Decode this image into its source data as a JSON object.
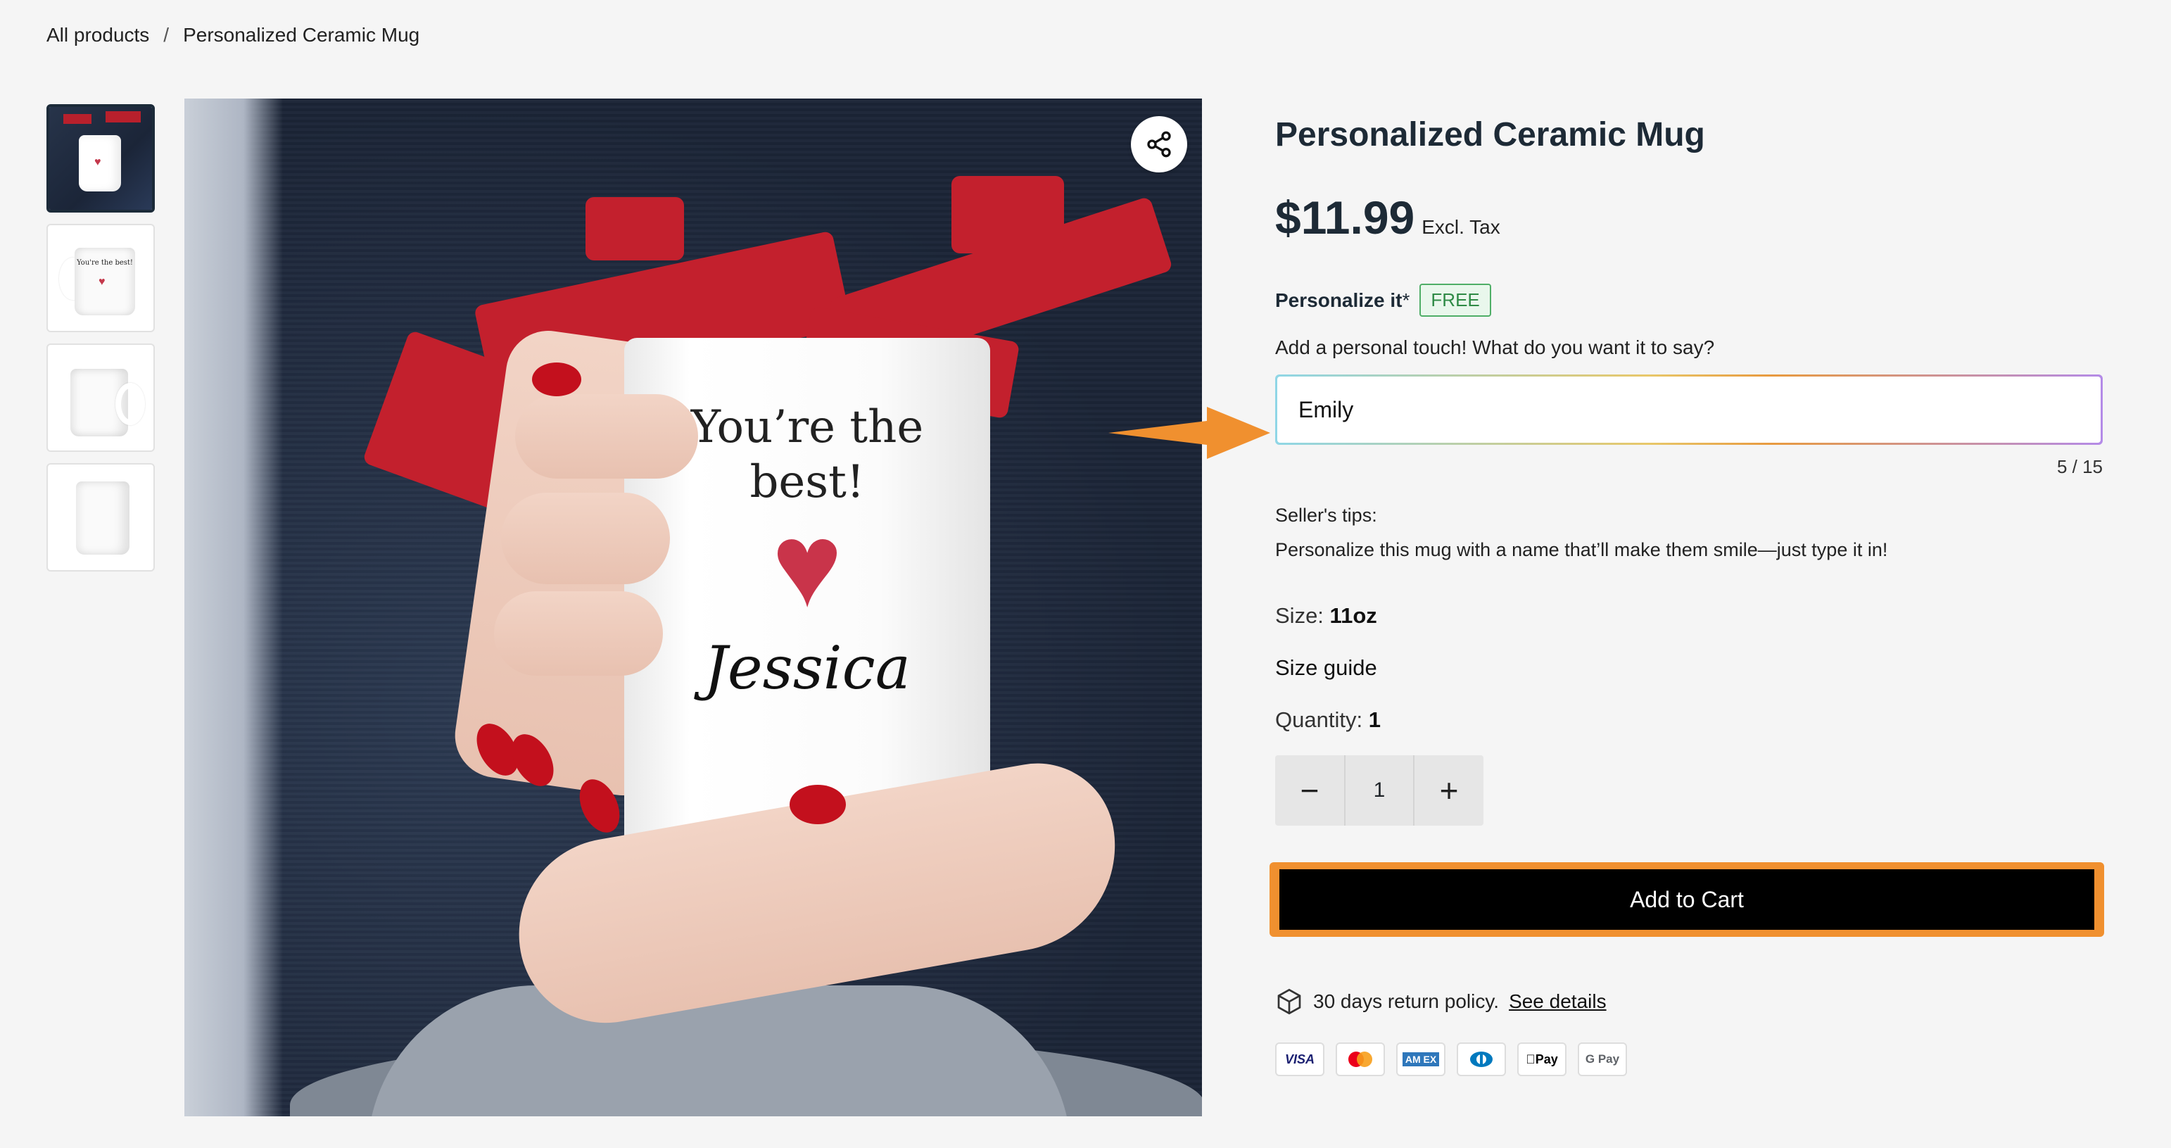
{
  "breadcrumb": {
    "root": "All products",
    "separator": "/",
    "current": "Personalized Ceramic Mug"
  },
  "gallery": {
    "mug_text_line1": "You’re the",
    "mug_text_line2": "best!",
    "mug_name": "Jessica",
    "thumb_text": "You're the best!"
  },
  "product": {
    "title": "Personalized Ceramic Mug",
    "price": "$11.99",
    "price_note": "Excl. Tax"
  },
  "personalize": {
    "label": "Personalize it",
    "required_mark": "*",
    "badge": "FREE",
    "prompt": "Add a personal touch! What do you want it to say?",
    "value": "Emily",
    "counter": "5 / 15"
  },
  "tips": {
    "title": "Seller's tips:",
    "text": "Personalize this mug with a name that’ll make them smile—just type it in!"
  },
  "options": {
    "size_label": "Size:",
    "size_value": "11oz",
    "size_guide": "Size guide",
    "qty_label": "Quantity:",
    "qty_value": "1",
    "stepper_value": "1",
    "minus": "−",
    "plus": "+"
  },
  "cart": {
    "label": "Add to Cart",
    "highlight_color": "#f0902f"
  },
  "policy": {
    "text": "30 days return policy.",
    "link": "See details"
  },
  "payments": [
    "VISA",
    "Mastercard",
    "AMEX",
    "Diners",
    "Apple Pay",
    "G Pay"
  ],
  "payment_labels": {
    "visa": "VISA",
    "amex": "AM EX",
    "apple": "Pay",
    "gpay": "G Pay"
  },
  "colors": {
    "accent_orange": "#f0902f",
    "free_green": "#2e8a45",
    "heart": "#c9344a"
  }
}
